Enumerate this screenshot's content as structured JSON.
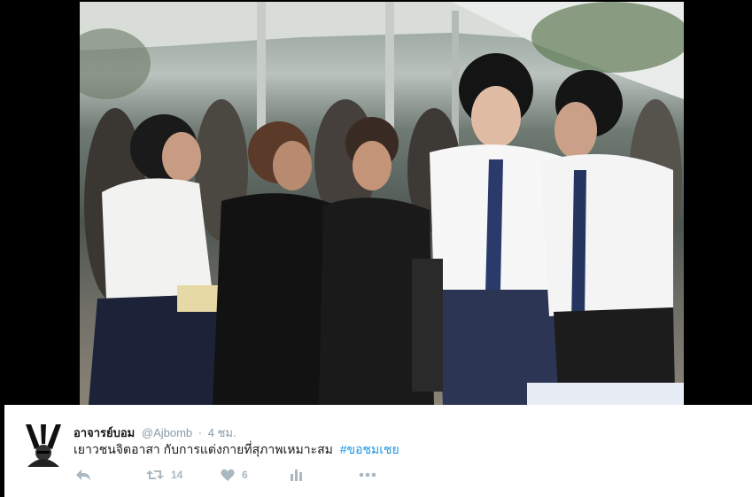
{
  "tweet": {
    "display_name": "อาจารย์บอม",
    "handle": "@Ajbomb",
    "separator": "·",
    "time": "4 ชม.",
    "text": "เยาวชนจิตอาสา กับการแต่งกายที่สุภาพเหมาะสม",
    "hashtag": "#ขอชมเชย",
    "retweet_count": "14",
    "like_count": "6"
  },
  "photo": {
    "subject": "students-volunteering"
  },
  "icons": {
    "reply": "reply-icon",
    "retweet": "retweet-icon",
    "like": "heart-icon",
    "analytics": "analytics-icon",
    "more": "more-icon"
  },
  "colors": {
    "hashtag": "#1b95e0",
    "muted": "#8899a6",
    "action": "#aab8c2",
    "text": "#14171a"
  }
}
